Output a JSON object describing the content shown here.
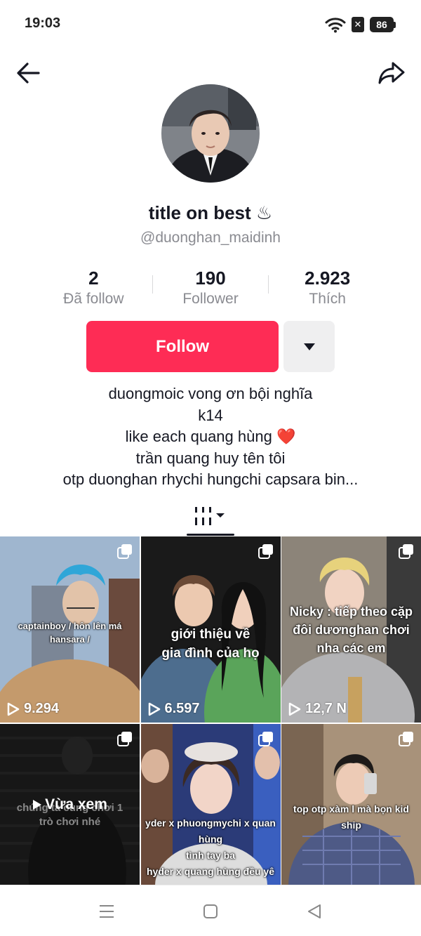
{
  "status_bar": {
    "time": "19:03",
    "icons": [
      "wifi-icon",
      "sim-off-icon",
      "battery-icon"
    ],
    "sim_glyph": "✕",
    "battery_level": "86"
  },
  "header": {
    "back_icon": "arrow-left-icon",
    "share_icon": "share-forward-icon"
  },
  "profile": {
    "display_name": "title on best ♨",
    "username": "@duonghan_maidinh",
    "stats": [
      {
        "value": "2",
        "label": "Đã follow"
      },
      {
        "value": "190",
        "label": "Follower"
      },
      {
        "value": "2.923",
        "label": "Thích"
      }
    ],
    "follow_label": "Follow",
    "more_icon": "caret-down-icon",
    "bio_lines": [
      "duongmoic vong ơn bội nghĩa",
      "k14",
      "like each quang hùng ❤️",
      "trần quang huy tên tôi",
      "otp duonghan rhychi hungchi capsara bin..."
    ]
  },
  "tabs": {
    "active_icon": "videos-grid-icon"
  },
  "videos": [
    {
      "caption": "captainboy / hôn lên má hansara /",
      "views": "9.294"
    },
    {
      "caption": "giới thiệu về gia đình của họ",
      "views": "6.597"
    },
    {
      "caption": "Nicky : tiếp theo cặp đôi dươnghan chơi nha các em",
      "views": "12,7 N"
    },
    {
      "caption": "chúng ta cùng chơi 1 trò chơi nhé",
      "watched_label": "Vừa xem"
    },
    {
      "caption_lines": [
        "yder x phuongmychi x quan",
        "hùng",
        "tình tay ba",
        "hyder x quang hùng đều yê"
      ]
    },
    {
      "caption": "top otp xàm l mà bọn kid ship"
    }
  ],
  "colors": {
    "accent": "#fe2c55",
    "text": "#161823",
    "secondary_text": "#8a8b91",
    "secondary_button": "#efeff0"
  },
  "system_nav": {
    "icons": [
      "menu-icon",
      "home-square-icon",
      "back-triangle-icon"
    ]
  }
}
